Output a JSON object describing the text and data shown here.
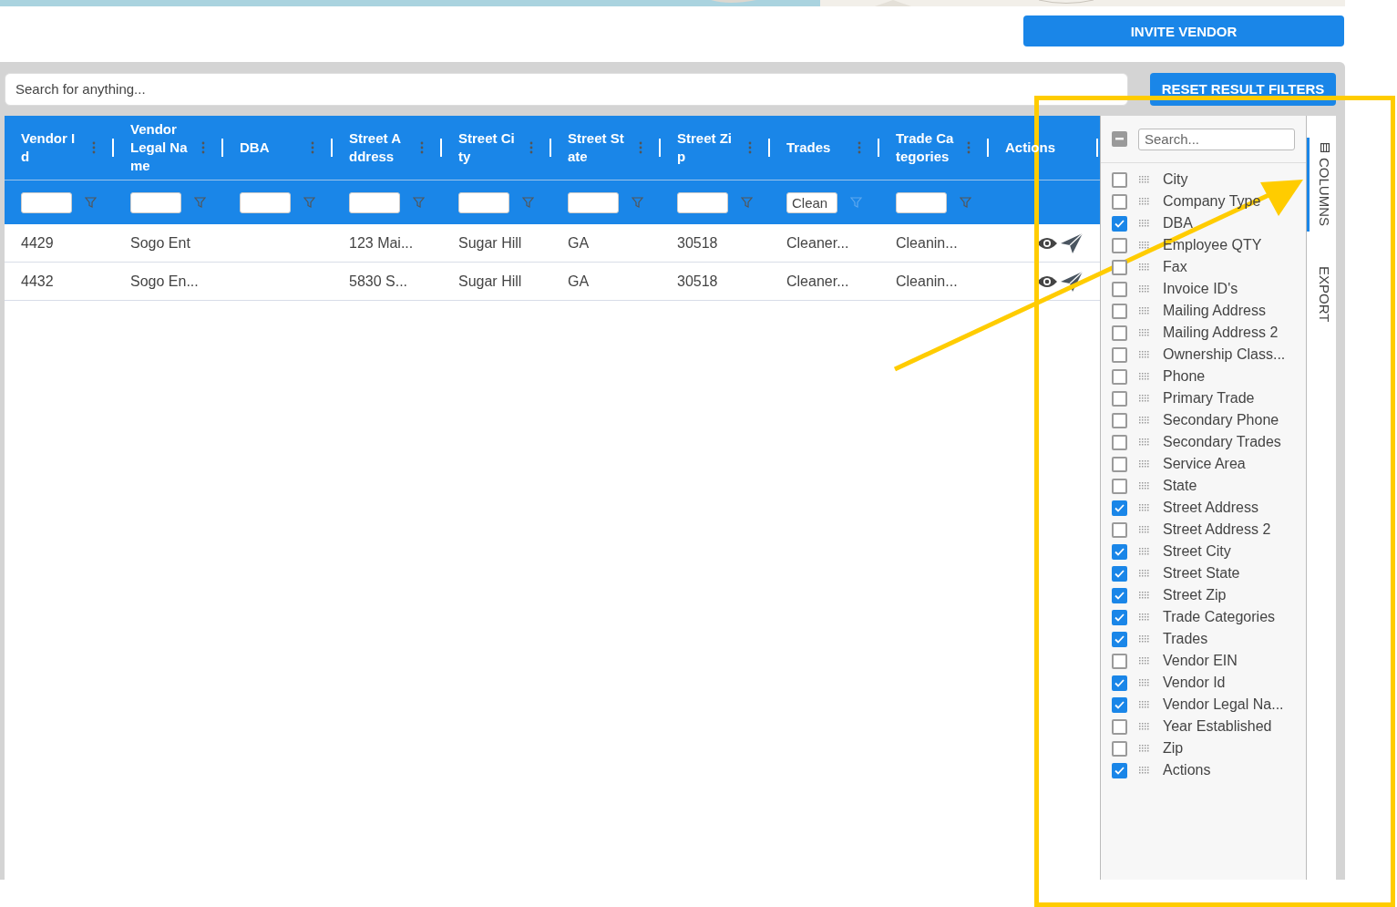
{
  "invite_button": "INVITE VENDOR",
  "search": {
    "placeholder": "Search for anything..."
  },
  "reset_button": "RESET RESULT FILTERS",
  "table": {
    "columns": [
      {
        "label": "Vendor Id",
        "kind": "data",
        "filtered": false
      },
      {
        "label": "Vendor Legal Name",
        "kind": "data",
        "filtered": false
      },
      {
        "label": "DBA",
        "kind": "data",
        "filtered": false
      },
      {
        "label": "Street Address",
        "kind": "data",
        "filtered": false
      },
      {
        "label": "Street City",
        "kind": "data",
        "filtered": false
      },
      {
        "label": "Street State",
        "kind": "data",
        "filtered": false
      },
      {
        "label": "Street Zip",
        "kind": "data",
        "filtered": false
      },
      {
        "label": "Trades",
        "kind": "data",
        "filter_value": "Clean",
        "filtered": true
      },
      {
        "label": "Trade Categories",
        "kind": "data",
        "filtered": false
      },
      {
        "label": "Actions",
        "kind": "actions"
      }
    ],
    "rows": [
      {
        "cells": [
          "4429",
          "Sogo Ent",
          "",
          "123 Mai...",
          "Sugar Hill",
          "GA",
          "30518",
          "Cleaner...",
          "Cleanin..."
        ]
      },
      {
        "cells": [
          "4432",
          "Sogo En...",
          "",
          "5830 S...",
          "Sugar Hill",
          "GA",
          "30518",
          "Cleaner...",
          "Cleanin..."
        ]
      }
    ]
  },
  "columns_panel": {
    "select_all_indeterminate": true,
    "search_placeholder": "Search...",
    "items": [
      {
        "label": "City",
        "checked": false
      },
      {
        "label": "Company Type",
        "checked": false
      },
      {
        "label": "DBA",
        "checked": true
      },
      {
        "label": "Employee QTY",
        "checked": false
      },
      {
        "label": "Fax",
        "checked": false
      },
      {
        "label": "Invoice ID's",
        "checked": false
      },
      {
        "label": "Mailing Address",
        "checked": false
      },
      {
        "label": "Mailing Address 2",
        "checked": false
      },
      {
        "label": "Ownership Class...",
        "checked": false
      },
      {
        "label": "Phone",
        "checked": false
      },
      {
        "label": "Primary Trade",
        "checked": false
      },
      {
        "label": "Secondary Phone",
        "checked": false
      },
      {
        "label": "Secondary Trades",
        "checked": false
      },
      {
        "label": "Service Area",
        "checked": false
      },
      {
        "label": "State",
        "checked": false
      },
      {
        "label": "Street Address",
        "checked": true
      },
      {
        "label": "Street Address 2",
        "checked": false
      },
      {
        "label": "Street City",
        "checked": true
      },
      {
        "label": "Street State",
        "checked": true
      },
      {
        "label": "Street Zip",
        "checked": true
      },
      {
        "label": "Trade Categories",
        "checked": true
      },
      {
        "label": "Trades",
        "checked": true
      },
      {
        "label": "Vendor EIN",
        "checked": false
      },
      {
        "label": "Vendor Id",
        "checked": true
      },
      {
        "label": "Vendor Legal Na...",
        "checked": true
      },
      {
        "label": "Year Established",
        "checked": false
      },
      {
        "label": "Zip",
        "checked": false
      },
      {
        "label": "Actions",
        "checked": true
      }
    ]
  },
  "side_tabs": [
    {
      "label": "COLUMNS",
      "selected": true
    },
    {
      "label": "EXPORT",
      "selected": false
    }
  ],
  "annotation": {
    "frame": true,
    "arrow": true
  }
}
